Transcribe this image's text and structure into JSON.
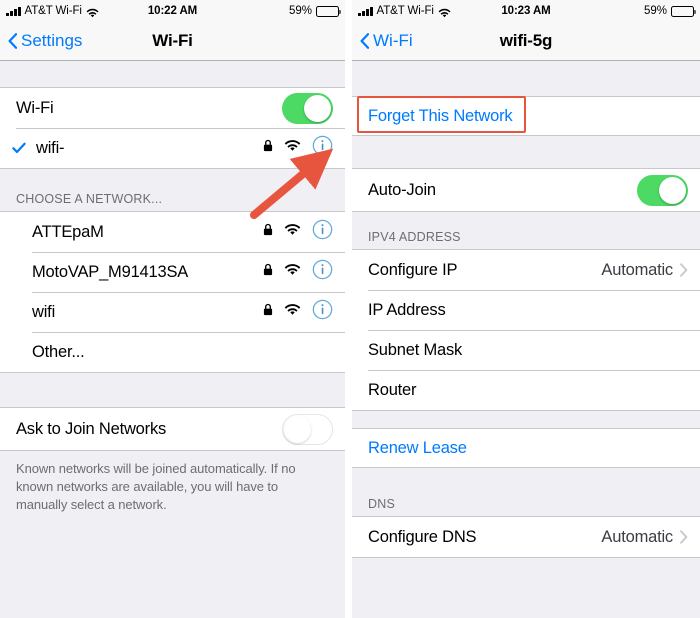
{
  "left": {
    "status_bar": {
      "carrier": "AT&T Wi-Fi",
      "time": "10:22 AM",
      "battery_percent": "59%",
      "signal_icon": "cellular-bars-icon",
      "wifi_icon": "wifi-icon",
      "battery_icon": "battery-icon"
    },
    "nav": {
      "back_label": "Settings",
      "title": "Wi-Fi",
      "back_icon": "chevron-left-icon"
    },
    "wifi_row": {
      "label": "Wi-Fi",
      "toggle_state": "on"
    },
    "connected_network": {
      "name": "wifi-",
      "checked": true,
      "lock_icon": "lock-icon",
      "signal_icon": "wifi-icon",
      "info_icon": "info-circle-icon"
    },
    "choose_header": "CHOOSE A NETWORK...",
    "networks": [
      {
        "name": "ATTEpaM",
        "secured": true,
        "has_info": true
      },
      {
        "name": "MotoVAP_M91413SA",
        "secured": true,
        "has_info": true
      },
      {
        "name": "wifi",
        "secured": true,
        "has_info": true
      }
    ],
    "other_label": "Other...",
    "ask_to_join": {
      "label": "Ask to Join Networks",
      "toggle_state": "off"
    },
    "footer_note": "Known networks will be joined automatically. If no known networks are available, you will have to manually select a network."
  },
  "right": {
    "status_bar": {
      "carrier": "AT&T Wi-Fi",
      "time": "10:23 AM",
      "battery_percent": "59%"
    },
    "nav": {
      "back_label": "Wi-Fi",
      "title": "wifi-5g"
    },
    "forget_label": "Forget This Network",
    "auto_join": {
      "label": "Auto-Join",
      "toggle_state": "on"
    },
    "ipv4_header": "IPV4 ADDRESS",
    "ipv4_rows": [
      {
        "label": "Configure IP",
        "value": "Automatic",
        "chevron": true
      },
      {
        "label": "IP Address",
        "value": "",
        "chevron": false
      },
      {
        "label": "Subnet Mask",
        "value": "",
        "chevron": false
      },
      {
        "label": "Router",
        "value": "",
        "chevron": false
      }
    ],
    "renew_lease_label": "Renew Lease",
    "dns_header": "DNS",
    "dns_rows": [
      {
        "label": "Configure DNS",
        "value": "Automatic",
        "chevron": true
      }
    ]
  },
  "annotations": {
    "arrow_color": "#E8553E",
    "highlight_color": "#E8553E",
    "arrow_target": "info-circle-icon of connected network"
  },
  "colors": {
    "accent_blue": "#007AFF",
    "toggle_green": "#4CD964",
    "background_gray": "#EFEFF4",
    "separator": "#C8C7CC"
  }
}
